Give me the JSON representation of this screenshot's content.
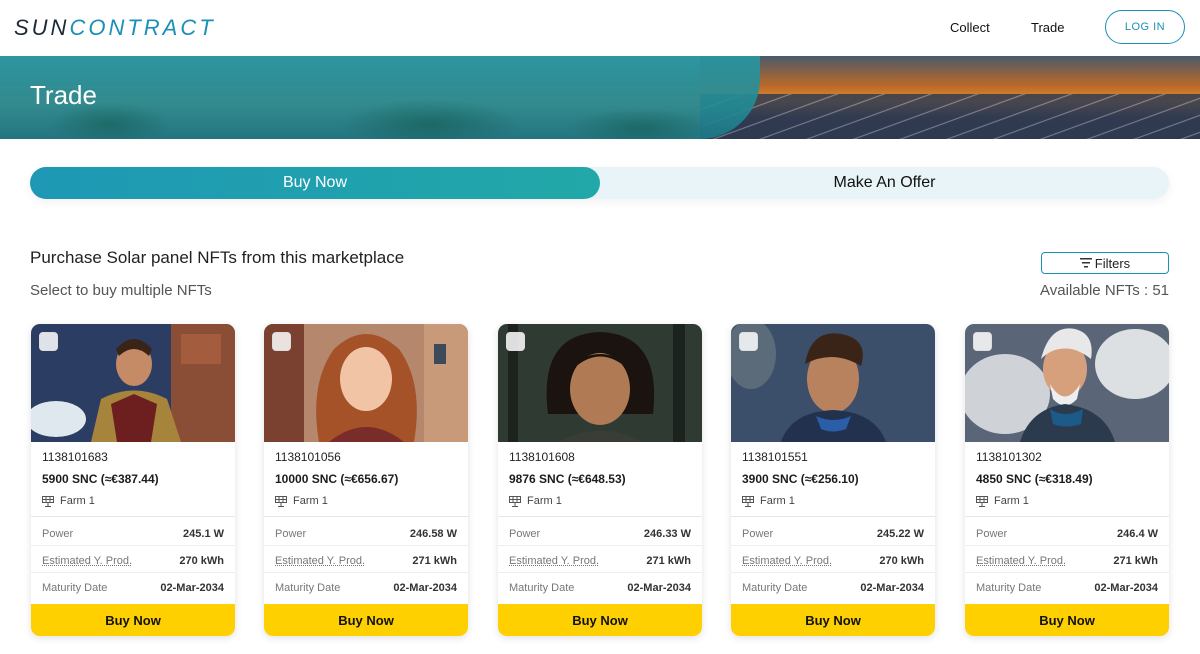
{
  "header": {
    "logo_part1": "SUN",
    "logo_part2": "CONTRACT",
    "nav": [
      "Collect",
      "Trade"
    ],
    "login_label": "LOG IN"
  },
  "hero": {
    "title": "Trade"
  },
  "tabs": {
    "buy_now": "Buy Now",
    "make_offer": "Make An Offer",
    "active": "Buy Now"
  },
  "section": {
    "title": "Purchase Solar panel NFTs from this marketplace",
    "subtitle": "Select to buy multiple NFTs",
    "filters_label": "Filters",
    "available": "Available NFTs : 51"
  },
  "colors": {
    "accent": "#1a8fb8",
    "buy_button": "#ffd000"
  },
  "cards": [
    {
      "id": "1138101683",
      "price": "5900 SNC (≈€387.44)",
      "farm": "Farm 1",
      "power_label": "Power",
      "power": "245.1 W",
      "prod_label": "Estimated Y. Prod.",
      "prod": "270 kWh",
      "maturity_label": "Maturity Date",
      "maturity": "02-Mar-2034",
      "button": "Buy Now"
    },
    {
      "id": "1138101056",
      "price": "10000 SNC (≈€656.67)",
      "farm": "Farm 1",
      "power_label": "Power",
      "power": "246.58 W",
      "prod_label": "Estimated Y. Prod.",
      "prod": "271 kWh",
      "maturity_label": "Maturity Date",
      "maturity": "02-Mar-2034",
      "button": "Buy Now"
    },
    {
      "id": "1138101608",
      "price": "9876 SNC (≈€648.53)",
      "farm": "Farm 1",
      "power_label": "Power",
      "power": "246.33 W",
      "prod_label": "Estimated Y. Prod.",
      "prod": "271 kWh",
      "maturity_label": "Maturity Date",
      "maturity": "02-Mar-2034",
      "button": "Buy Now"
    },
    {
      "id": "1138101551",
      "price": "3900 SNC (≈€256.10)",
      "farm": "Farm 1",
      "power_label": "Power",
      "power": "245.22 W",
      "prod_label": "Estimated Y. Prod.",
      "prod": "270 kWh",
      "maturity_label": "Maturity Date",
      "maturity": "02-Mar-2034",
      "button": "Buy Now"
    },
    {
      "id": "1138101302",
      "price": "4850 SNC (≈€318.49)",
      "farm": "Farm 1",
      "power_label": "Power",
      "power": "246.4 W",
      "prod_label": "Estimated Y. Prod.",
      "prod": "271 kWh",
      "maturity_label": "Maturity Date",
      "maturity": "02-Mar-2034",
      "button": "Buy Now"
    }
  ]
}
